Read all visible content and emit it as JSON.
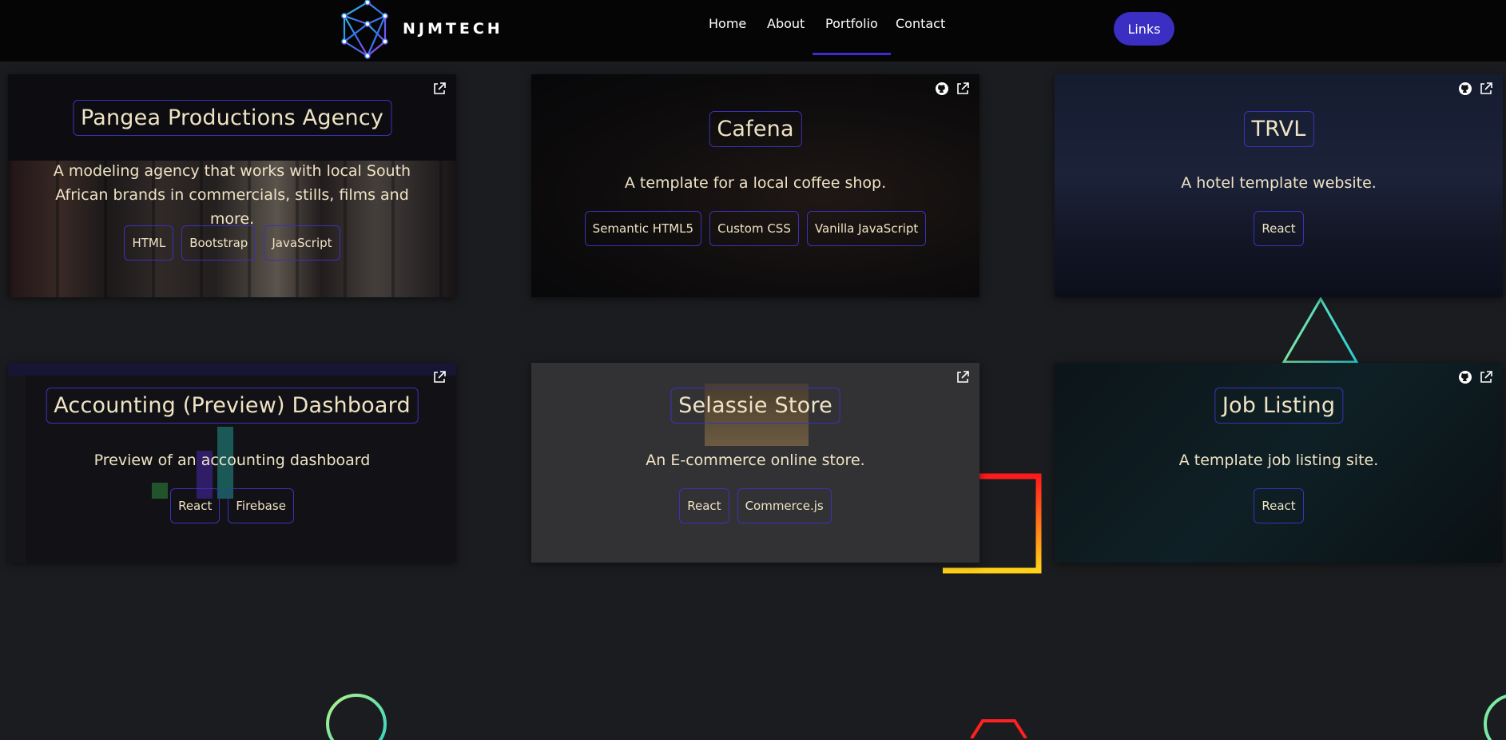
{
  "nav": {
    "brand": "NJMTECH",
    "links": [
      "Home",
      "About",
      "Portfolio",
      "Contact"
    ],
    "active": "Portfolio",
    "cta_label": "Links"
  },
  "colors": {
    "accent": "#3a2fc2",
    "badge_border": "#3b31b8",
    "card_text": "#efe3c4",
    "background": "#1b1c1f"
  },
  "projects": [
    {
      "title": "Pangea Productions Agency",
      "description": "A modeling agency that works with local South African brands in commercials, stills, films and more.",
      "tags": [
        "HTML",
        "Bootstrap",
        "JavaScript"
      ],
      "icons": [
        "external-link-icon"
      ]
    },
    {
      "title": "Cafena",
      "description": "A template for a local coffee shop.",
      "tags": [
        "Semantic HTML5",
        "Custom CSS",
        "Vanilla JavaScript"
      ],
      "icons": [
        "github-icon",
        "external-link-icon"
      ]
    },
    {
      "title": "TRVL",
      "description": "A hotel template website.",
      "tags": [
        "React"
      ],
      "icons": [
        "github-icon",
        "external-link-icon"
      ]
    },
    {
      "title": "Accounting (Preview) Dashboard",
      "description": "Preview of an accounting dashboard",
      "tags": [
        "React",
        "Firebase"
      ],
      "icons": [
        "external-link-icon"
      ]
    },
    {
      "title": "Selassie Store",
      "description": "An E-commerce online store.",
      "tags": [
        "React",
        "Commerce.js"
      ],
      "icons": [
        "external-link-icon"
      ]
    },
    {
      "title": "Job Listing",
      "description": "A template job listing site.",
      "tags": [
        "React"
      ],
      "icons": [
        "github-icon",
        "external-link-icon"
      ]
    }
  ]
}
